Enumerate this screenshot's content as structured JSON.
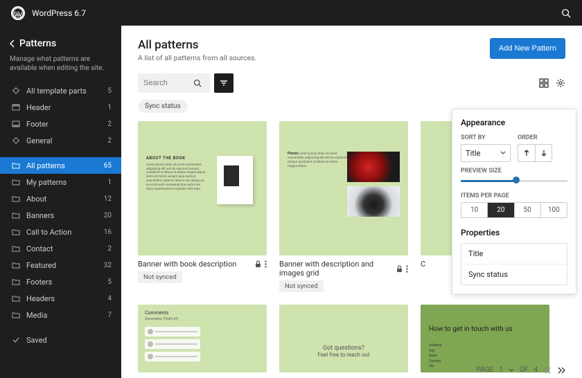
{
  "app": {
    "name": "WordPress 6.7"
  },
  "sidebar": {
    "title": "Patterns",
    "description": "Manage what patterns are available when editing the site.",
    "template_parts_label": "All template parts",
    "template_parts_count": "5",
    "parts": [
      {
        "label": "Header",
        "count": "1"
      },
      {
        "label": "Footer",
        "count": "2"
      },
      {
        "label": "General",
        "count": "2"
      }
    ],
    "patterns": [
      {
        "label": "All patterns",
        "count": "65"
      },
      {
        "label": "My patterns",
        "count": "1"
      },
      {
        "label": "About",
        "count": "12"
      },
      {
        "label": "Banners",
        "count": "20"
      },
      {
        "label": "Call to Action",
        "count": "16"
      },
      {
        "label": "Contact",
        "count": "2"
      },
      {
        "label": "Featured",
        "count": "32"
      },
      {
        "label": "Footers",
        "count": "5"
      },
      {
        "label": "Headers",
        "count": "4"
      },
      {
        "label": "Media",
        "count": "7"
      }
    ],
    "saved_label": "Saved"
  },
  "header": {
    "title": "All patterns",
    "subtitle": "A list of all patterns from all sources.",
    "add_btn": "Add New Pattern"
  },
  "toolbar": {
    "search_placeholder": "Search"
  },
  "chips": {
    "sync_status": "Sync status"
  },
  "cards": {
    "c1": {
      "title": "Banner with book description",
      "status": "Not synced",
      "heading": "ABOUT THE BOOK",
      "lorem": "Lorem ipsum dolor sit amet consectetur adipiscing elit sed do eiusmod tempor incididunt ut labore et dolore magna aliqua enim ad minim veniam quis nostrud exercitation ullamco laboris nisi aliquip ex ea commodo consequat duis aute irure dolor reprehenderit voluptate velit esse."
    },
    "c2": {
      "title": "Banner with description and images grid",
      "status": "Not synced",
      "heading": "Pieces",
      "lorem": "Lorem ipsum dolor sit amet consectetur adipiscing elit sed do eiusmod tempor incididunt ut labore et dolore magna aliqua."
    },
    "c3": {
      "title": "C"
    },
    "c4": {
      "heading": "Comments",
      "sub": "Comments (That's it!)"
    },
    "c5": {
      "q1": "Got questions?",
      "q2": "Feel free to reach out"
    },
    "c6": {
      "title": "How to get in touch with us",
      "list": "Address\nCity\nState\nCountry\nZip"
    }
  },
  "popover": {
    "appearance": "Appearance",
    "sort_by": "SORT BY",
    "sort_value": "Title",
    "order": "ORDER",
    "preview_size": "PREVIEW SIZE",
    "items_per_page": "ITEMS PER PAGE",
    "ipp": {
      "a": "10",
      "b": "20",
      "c": "50",
      "d": "100"
    },
    "properties": "Properties",
    "prop1": "Title",
    "prop2": "Sync status"
  },
  "pagination": {
    "page_label": "PAGE",
    "current": "1",
    "of": "OF",
    "total": "4"
  }
}
